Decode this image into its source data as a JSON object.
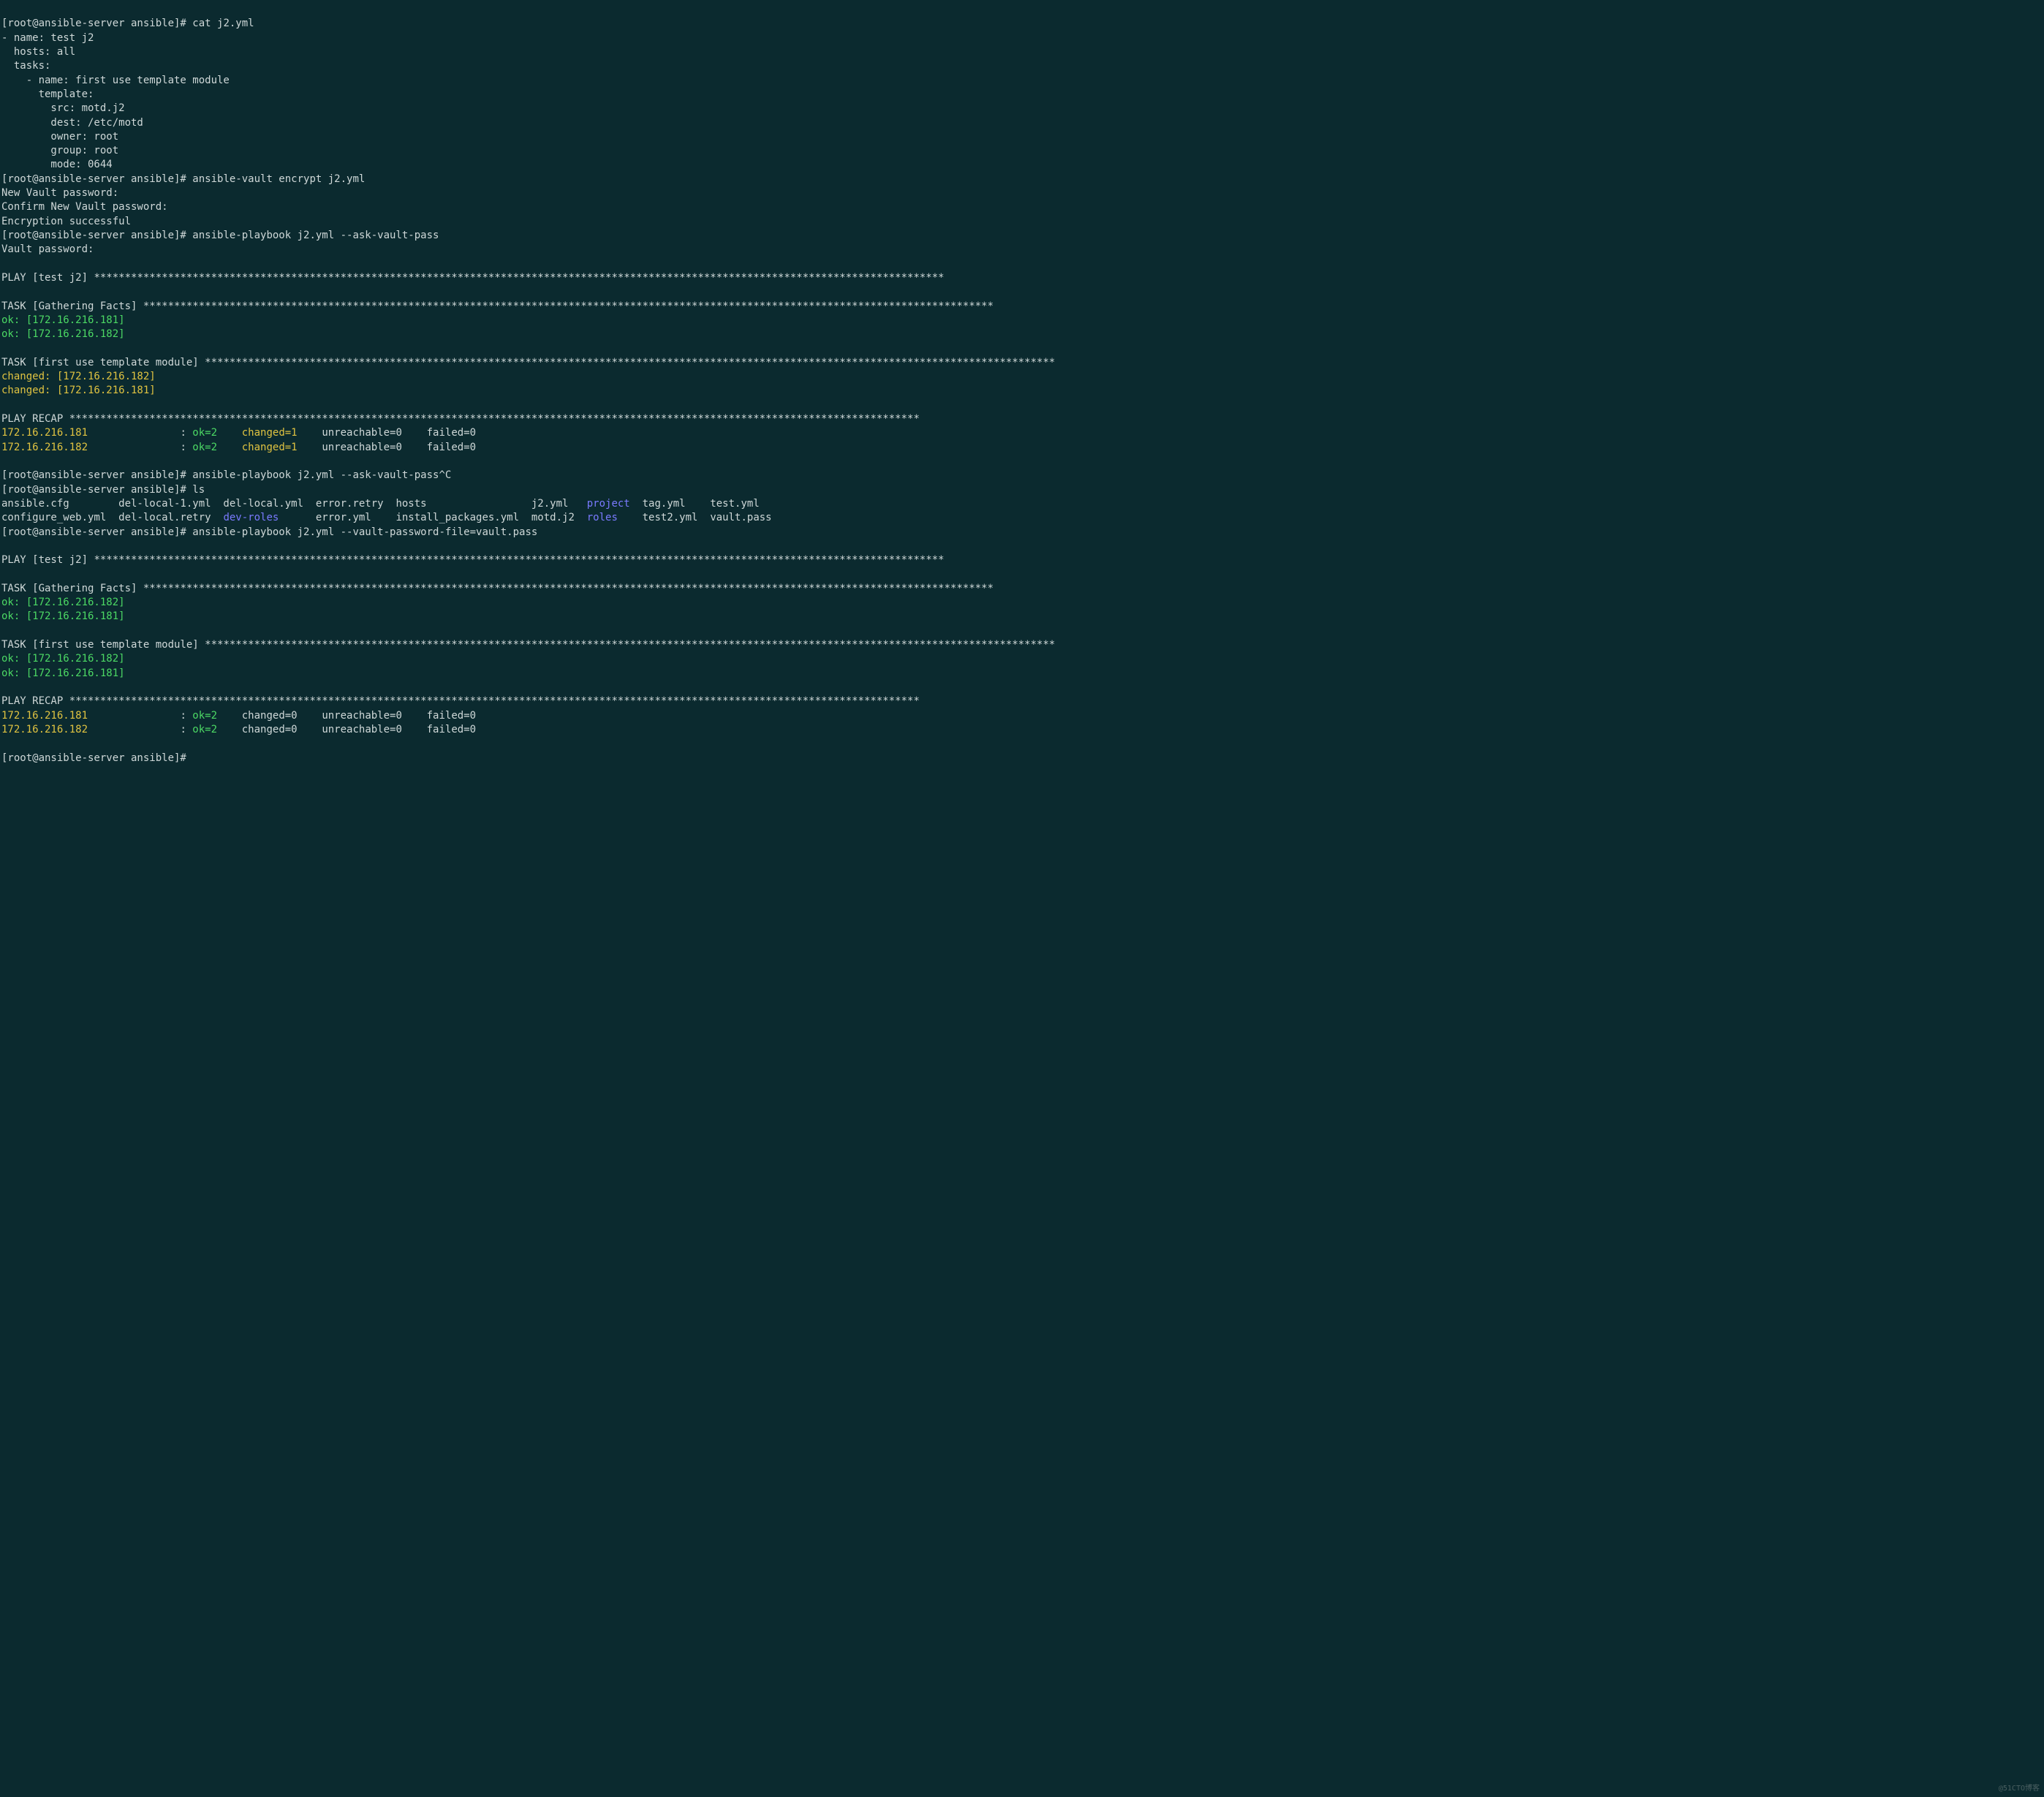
{
  "prompt": "[root@ansible-server ansible]# ",
  "cmds": {
    "cat": "cat j2.yml",
    "encrypt": "ansible-vault encrypt j2.yml",
    "pb_ask": "ansible-playbook j2.yml --ask-vault-pass",
    "pb_ask_c": "ansible-playbook j2.yml --ask-vault-pass^C",
    "ls": "ls",
    "pb_file": "ansible-playbook j2.yml --vault-password-file=vault.pass"
  },
  "yaml": {
    "l1": "- name: test j2",
    "l2": "  hosts: all",
    "l3": "  tasks:",
    "l4": "    - name: first use template module",
    "l5": "      template:",
    "l6": "        src: motd.j2",
    "l7": "        dest: /etc/motd",
    "l8": "        owner: root",
    "l9": "        group: root",
    "l10": "        mode: 0644"
  },
  "vault": {
    "new": "New Vault password:",
    "confirm": "Confirm New Vault password:",
    "success": "Encryption successful",
    "ask": "Vault password:"
  },
  "play": {
    "header": "PLAY [test j2] ",
    "gather": "TASK [Gathering Facts] ",
    "task_template": "TASK [first use template module] ",
    "recap": "PLAY RECAP ",
    "stars": "******************************************************************************************************************************************",
    "ok181": "ok: [172.16.216.181]",
    "ok182": "ok: [172.16.216.182]",
    "changed181": "changed: [172.16.216.181]",
    "changed182": "changed: [172.16.216.182]"
  },
  "recap1": {
    "col0": "172.16.216.181               ",
    "col0b": "172.16.216.182               ",
    "colon": ": ",
    "ok": "ok=2   ",
    "changed": " changed=1   ",
    "rest": " unreachable=0    failed=0"
  },
  "recap2": {
    "ok": "ok=2   ",
    "changed": " changed=0    unreachable=0    failed=0"
  },
  "ls_out": {
    "r1_c1": "ansible.cfg        del-local-1.yml  del-local.yml  error.retry  hosts                 j2.yml   ",
    "r1_proj": "project",
    "r1_c3": "  tag.yml    test.yml",
    "r2_c1": "configure_web.yml  del-local.retry  ",
    "r2_dev": "dev-roles",
    "r2_c2": "      error.yml    install_packages.yml  motd.j2  ",
    "r2_roles": "roles",
    "r2_c3": "    test2.yml  vault.pass"
  },
  "watermark": "@51CTO博客"
}
